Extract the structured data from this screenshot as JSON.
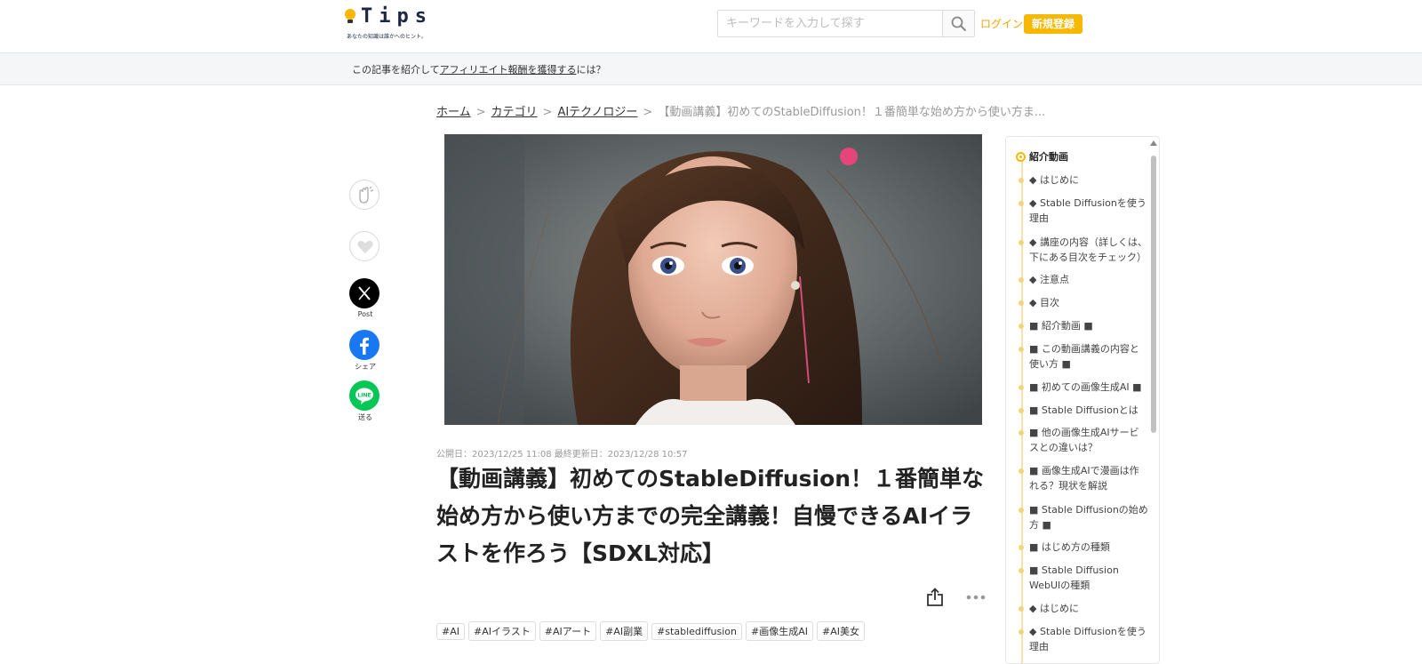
{
  "header": {
    "logo_text": "Tips",
    "logo_tagline": "あなたの知識は誰かへのヒント。",
    "search_placeholder": "キーワードを入力して探す",
    "login_label": "ログイン",
    "signup_label": "新規登録"
  },
  "affiliate_bar": {
    "prefix": "この記事を紹介して",
    "link": "アフィリエイト報酬を獲得する",
    "suffix": "には？"
  },
  "breadcrumb": {
    "home": "ホーム",
    "category": "カテゴリ",
    "subcategory": "AIテクノロジー",
    "current": "【動画講義】初めてのStableDiffusion！１番簡単な始め方から使い方ま..."
  },
  "share": {
    "post_label": "Post",
    "facebook_label": "シェア",
    "line_label": "送る",
    "line_icon_text": "LINE"
  },
  "article": {
    "dates": "公開日：2023/12/25 11:08 最終更新日：2023/12/28 10:57",
    "title": "【動画講義】初めてのStableDiffusion！１番簡単な始め方から使い方までの完全講義！自慢できるAIイラストを作ろう【SDXL対応】",
    "tags": [
      "#AI",
      "#AIイラスト",
      "#AIアート",
      "#AI副業",
      "#stablediffusion",
      "#画像生成AI",
      "#AI美女"
    ]
  },
  "toc": {
    "items": [
      "紹介動画",
      "◆ はじめに",
      "◆ Stable Diffusionを使う理由",
      "◆ 講座の内容（詳しくは、下にある目次をチェック）",
      "◆ 注意点",
      "◆ 目次",
      "■ 紹介動画 ■",
      "■ この動画講義の内容と使い方 ■",
      "■ 初めての画像生成AI ■",
      "■ Stable Diffusionとは",
      "■ 他の画像生成AIサービスとの違いは？",
      "■ 画像生成AIで漫画は作れる？現状を解説",
      "■ Stable Diffusionの始め方 ■",
      "■ はじめ方の種類",
      "■ Stable Diffusion WebUIの種類",
      "◆ はじめに",
      "◆ Stable Diffusionを使う理由"
    ]
  },
  "colors": {
    "brand_yellow": "#f6b800",
    "login_text": "#f0a500",
    "facebook_blue": "#1877f2",
    "line_green": "#06c755",
    "x_black": "#000000"
  }
}
